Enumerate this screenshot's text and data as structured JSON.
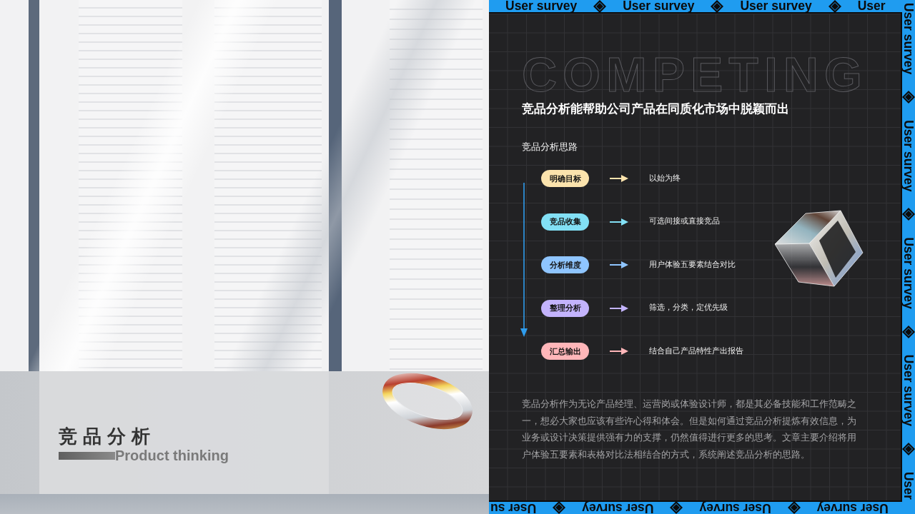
{
  "cover": {
    "title": "竞品分析",
    "subtitle": "Product thinking"
  },
  "ribbons": {
    "top": [
      "User survey",
      "User survey",
      "User survey",
      "User"
    ],
    "side": [
      "User survey",
      "User survey",
      "User survey",
      "User survey",
      "User"
    ],
    "bottom": [
      "User survey",
      "User survey",
      "User survey",
      "User su"
    ]
  },
  "backdrop_word": "COMPETING",
  "headline": "竞品分析能帮助公司产品在同质化市场中脱颖而出",
  "section_title": "竞品分析思路",
  "steps": [
    {
      "label": "明确目标",
      "description": "以始为终",
      "color": "#fbe3ad"
    },
    {
      "label": "竞品收集",
      "description": "可选间接或直接竞品",
      "color": "#82e0f5"
    },
    {
      "label": "分析维度",
      "description": "用户体验五要素结合对比",
      "color": "#8fc5ff"
    },
    {
      "label": "整理分析",
      "description": "筛选，分类，定优先级",
      "color": "#c3b3fc"
    },
    {
      "label": "汇总输出",
      "description": "结合自己产品特性产出报告",
      "color": "#ffb6b9"
    }
  ],
  "paragraph": "竞品分析作为无论产品经理、运营岗或体验设计师，都是其必备技能和工作范畴之一，想必大家也应该有些许心得和体会。但是如何通过竞品分析提炼有效信息，为业务或设计决策提供强有力的支撑，仍然值得进行更多的思考。文章主要介绍将用户体验五要素和表格对比法相结合的方式，系统阐述竞品分析的思路。"
}
